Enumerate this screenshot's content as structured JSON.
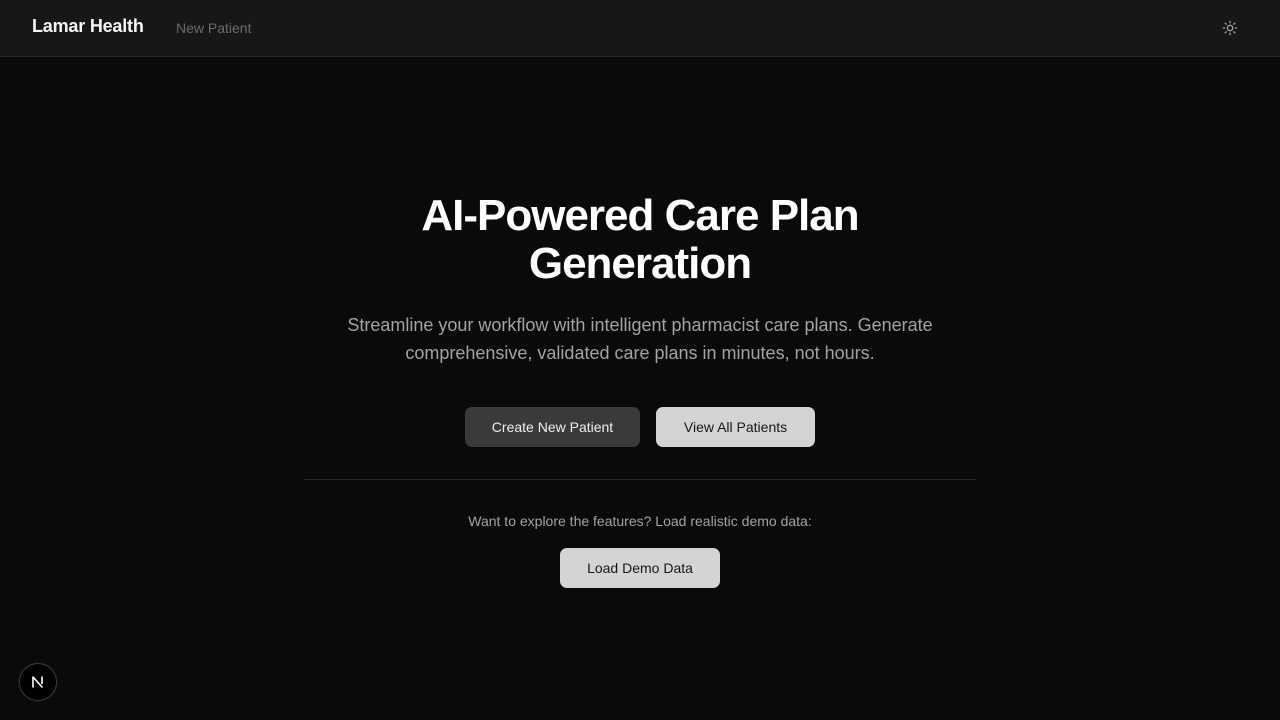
{
  "header": {
    "brand": "Lamar Health",
    "nav": [
      {
        "label": "New Patient"
      }
    ],
    "theme_toggle_icon": "sun-icon"
  },
  "hero": {
    "title": "AI-Powered Care Plan Generation",
    "subtitle": "Streamline your workflow with intelligent pharmacist care plans. Generate comprehensive, validated care plans in minutes, not hours.",
    "primary_button": "Create New Patient",
    "secondary_button": "View All Patients"
  },
  "demo": {
    "prompt": "Want to explore the features? Load realistic demo data:",
    "button": "Load Demo Data"
  },
  "badge": {
    "letter": "N",
    "icon": "nextjs-logo-icon"
  },
  "colors": {
    "background": "#0a0a0a",
    "header": "#171717",
    "muted_text": "#a3a3a3",
    "dark_button": "#3a3a3a",
    "light_button": "#d4d4d4"
  }
}
